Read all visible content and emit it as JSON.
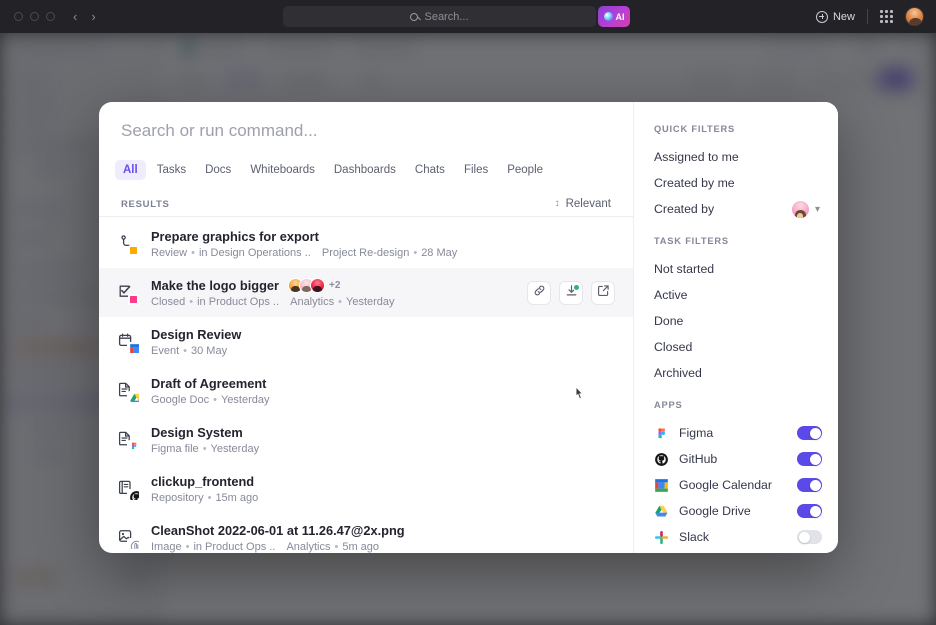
{
  "browser": {
    "traffic_lights": [
      "close",
      "minimize",
      "maximize"
    ],
    "back_glyph": "‹",
    "forward_glyph": "›",
    "omnibox_placeholder": "Search...",
    "ai_button_label": "AI",
    "new_button_label": "New",
    "apps_grid_icon": "grid-icon",
    "avatar_icon": "user-avatar"
  },
  "palette": {
    "search_placeholder": "Search or run command...",
    "search_value": "",
    "tabs": [
      {
        "label": "All",
        "active": true
      },
      {
        "label": "Tasks",
        "active": false
      },
      {
        "label": "Docs",
        "active": false
      },
      {
        "label": "Whiteboards",
        "active": false
      },
      {
        "label": "Dashboards",
        "active": false
      },
      {
        "label": "Chats",
        "active": false
      },
      {
        "label": "Files",
        "active": false
      },
      {
        "label": "People",
        "active": false
      }
    ],
    "results_label": "RESULTS",
    "sort_label": "Relevant",
    "results": [
      {
        "title": "Prepare graphics for export",
        "meta": [
          "Review",
          "in Design Operations ..",
          "Project Re-design",
          "28 May"
        ],
        "icon": "task-icon",
        "status_color": "#FFA800",
        "hovered": false,
        "avatars": [],
        "avatar_overflow": "",
        "actions": []
      },
      {
        "title": "Make the logo bigger",
        "meta": [
          "Closed",
          "in Product Ops ..",
          "Analytics",
          "Yesterday"
        ],
        "icon": "task-complete-icon",
        "status_color": "#FB3A8C",
        "hovered": true,
        "avatars": [
          "av-1",
          "av-2",
          "av-3"
        ],
        "avatar_overflow": "+2",
        "actions": [
          "link-icon",
          "merge-icon",
          "open-external-icon"
        ]
      },
      {
        "title": "Design Review",
        "meta": [
          "Event",
          "30 May"
        ],
        "icon": "calendar-icon",
        "badge": "google-calendar-badge",
        "hovered": false,
        "avatars": [],
        "avatar_overflow": "",
        "actions": []
      },
      {
        "title": "Draft of Agreement",
        "meta": [
          "Google Doc",
          "Yesterday"
        ],
        "icon": "document-icon",
        "badge": "google-drive-badge",
        "hovered": false,
        "avatars": [],
        "avatar_overflow": "",
        "actions": []
      },
      {
        "title": "Design System",
        "meta": [
          "Figma file",
          "Yesterday"
        ],
        "icon": "document-icon",
        "badge": "figma-badge",
        "hovered": false,
        "avatars": [],
        "avatar_overflow": "",
        "actions": []
      },
      {
        "title": "clickup_frontend",
        "meta": [
          "Repository",
          "15m ago"
        ],
        "icon": "repository-icon",
        "badge": "github-badge",
        "hovered": false,
        "avatars": [],
        "avatar_overflow": "",
        "actions": []
      },
      {
        "title": "CleanShot 2022-06-01 at 11.26.47@2x.png",
        "meta": [
          "Image",
          "in Product Ops ..",
          "Analytics",
          "5m ago"
        ],
        "icon": "image-icon",
        "badge": "attachment-badge",
        "hovered": false,
        "avatars": [],
        "avatar_overflow": "",
        "actions": []
      }
    ]
  },
  "filters": {
    "quick_filters_label": "QUICK FILTERS",
    "quick_filters": [
      {
        "label": "Assigned to me",
        "has_avatar": false
      },
      {
        "label": "Created by me",
        "has_avatar": false
      },
      {
        "label": "Created by",
        "has_avatar": true
      }
    ],
    "task_filters_label": "TASK FILTERS",
    "task_filters": [
      {
        "label": "Not started"
      },
      {
        "label": "Active"
      },
      {
        "label": "Done"
      },
      {
        "label": "Closed"
      },
      {
        "label": "Archived"
      }
    ],
    "apps_label": "APPS",
    "apps": [
      {
        "label": "Figma",
        "icon": "figma-icon",
        "enabled": true
      },
      {
        "label": "GitHub",
        "icon": "github-icon",
        "enabled": true
      },
      {
        "label": "Google Calendar",
        "icon": "google-calendar-icon",
        "enabled": true
      },
      {
        "label": "Google Drive",
        "icon": "google-drive-icon",
        "enabled": true
      },
      {
        "label": "Slack",
        "icon": "slack-icon",
        "enabled": false
      }
    ]
  },
  "colors": {
    "accent": "#5B4AE8",
    "tab_active_bg": "#EEECFD",
    "tab_active_text": "#6B4EE8",
    "status_orange": "#FFA800",
    "status_pink": "#FB3A8C",
    "toggle_on": "#5B4AE8",
    "toggle_off": "#E2E3E9"
  }
}
